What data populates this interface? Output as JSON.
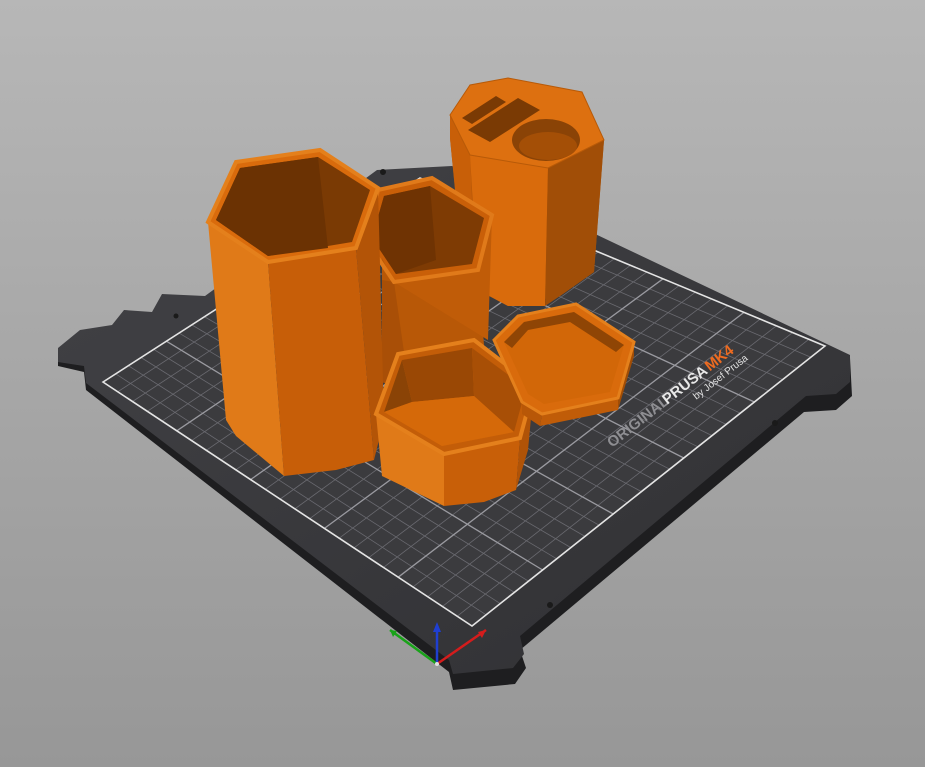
{
  "bed": {
    "brand_prefix": "ORIGINAL",
    "brand_name": "PRUSA",
    "model": "MK4",
    "byline": "by Josef Prusa"
  },
  "colors": {
    "background_top": "#b7b7b7",
    "background_bottom": "#979797",
    "bed_surface": "#3a3a3c",
    "bed_grid": "#5a5a5e",
    "bed_border": "#d8d8d8",
    "model_orange": "#d96b0c",
    "model_orange_dark": "#8a4306",
    "model_orange_mid": "#b45708",
    "brand_orange": "#ed6b21",
    "axis_x": "#d41c1c",
    "axis_y": "#19a319",
    "axis_z": "#1f3fd1"
  },
  "axes": {
    "x_icon": "x-axis-arrow",
    "y_icon": "y-axis-arrow",
    "z_icon": "z-axis-arrow"
  }
}
